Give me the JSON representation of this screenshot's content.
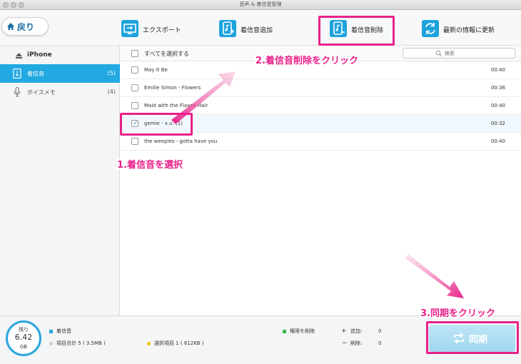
{
  "window": {
    "title": "音声 & 着信音管理"
  },
  "toolbar": {
    "back_label": "戻り",
    "export_label": "エクスポート",
    "add_label": "着信音追加",
    "delete_label": "着信音削除",
    "refresh_label": "最新の情報に更新"
  },
  "sidebar": {
    "device": "iPhone",
    "items": [
      {
        "label": "着信音",
        "count": "(5)"
      },
      {
        "label": "ボイスメモ",
        "count": "(4)"
      }
    ]
  },
  "list": {
    "select_all": "すべてを選択する",
    "search_placeholder": "検索",
    "rows": [
      {
        "title": "May It Be",
        "duration": "00:40",
        "checked": false
      },
      {
        "title": "Emilie Simon - Flowers",
        "duration": "00:36",
        "checked": false
      },
      {
        "title": "Maid with the Flaxen Hair",
        "duration": "00:40",
        "checked": false
      },
      {
        "title": "gemie - x.u. (1)",
        "duration": "00:32",
        "checked": true
      },
      {
        "title": "the weepies - gotta have you",
        "duration": "00:40",
        "checked": false
      }
    ]
  },
  "status": {
    "remaining_label": "残り",
    "remaining_value": "6.42",
    "remaining_unit": "GB",
    "category": "着信音",
    "total_items": "項目合計 5 ( 3.5MB )",
    "selected_items": "選択項目 1 ( 612KB )",
    "permission": "権限を削除",
    "add_label": "追加:",
    "add_count": "0",
    "remove_label": "削除:",
    "remove_count": "0"
  },
  "sync_label": "同期",
  "annotations": {
    "step1": "1.着信音を選択",
    "step2": "2.着信音削除をクリック",
    "step3": "3.同期をクリック"
  },
  "colors": {
    "accent": "#22a9e2",
    "annotation": "#e8218a"
  }
}
